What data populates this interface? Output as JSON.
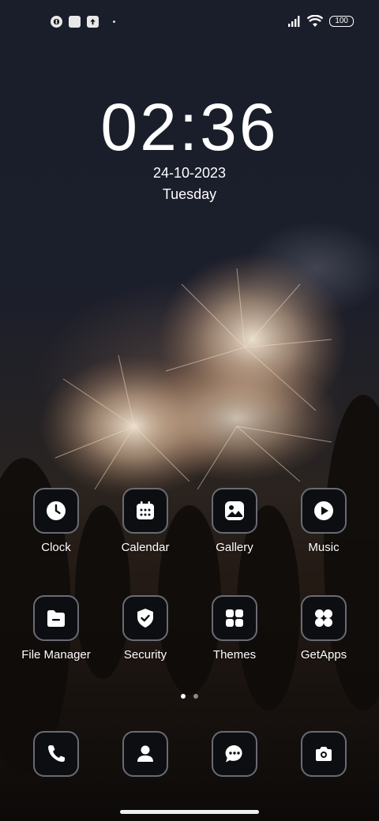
{
  "status_bar": {
    "battery": "100",
    "left_icons": [
      "notification-app-icon",
      "square-notification-icon",
      "upload-icon"
    ],
    "right_icons": [
      "signal-icon",
      "wifi-icon",
      "battery-icon"
    ]
  },
  "lock": {
    "time": "02:36",
    "date": "24-10-2023",
    "weekday": "Tuesday"
  },
  "apps": [
    {
      "label": "Clock",
      "icon": "clock-icon"
    },
    {
      "label": "Calendar",
      "icon": "calendar-icon"
    },
    {
      "label": "Gallery",
      "icon": "gallery-icon"
    },
    {
      "label": "Music",
      "icon": "music-icon"
    },
    {
      "label": "File Manager",
      "icon": "folder-icon"
    },
    {
      "label": "Security",
      "icon": "shield-icon"
    },
    {
      "label": "Themes",
      "icon": "themes-icon"
    },
    {
      "label": "GetApps",
      "icon": "getapps-icon"
    }
  ],
  "dock": [
    {
      "icon": "phone-icon"
    },
    {
      "icon": "contacts-icon"
    },
    {
      "icon": "messages-icon"
    },
    {
      "icon": "camera-icon"
    }
  ],
  "page_indicator": {
    "pages": 2,
    "active": 1
  },
  "colors": {
    "icon_bg": "#0d0e12",
    "icon_border": "#6a6b72",
    "text": "#ffffff"
  }
}
